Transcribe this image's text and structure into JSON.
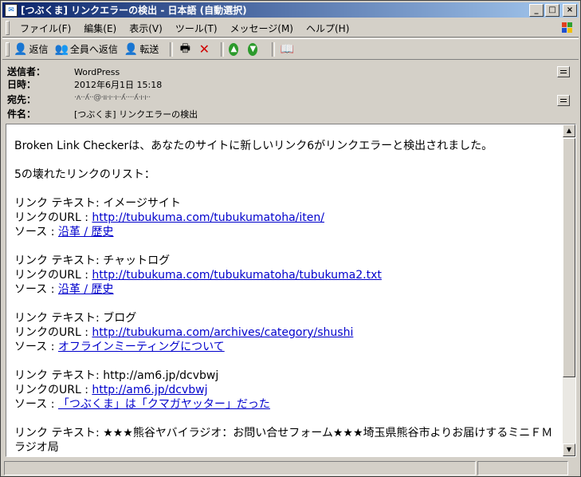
{
  "window": {
    "title": "[つぶくま] リンクエラーの検出 - 日本語 (自動選択)",
    "controls": [
      "_",
      "□",
      "×"
    ]
  },
  "menu": [
    "ファイル(F)",
    "編集(E)",
    "表示(V)",
    "ツール(T)",
    "メッセージ(M)",
    "ヘルプ(H)"
  ],
  "toolbar": {
    "reply": "返信",
    "reply_all": "全員へ返信",
    "forward": "転送"
  },
  "header": {
    "from_label": "送信者：",
    "from": "WordPress",
    "date_label": "日時：",
    "date": "2012年6月1日 15:18",
    "to_label": "宛先：",
    "to": "·ʌ··ʎ··@·ıı·ı··ı··ʎ····ʎ·ı·ı··",
    "subject_label": "件名：",
    "subject": "[つぶくま] リンクエラーの検出"
  },
  "body": {
    "intro": "Broken Link Checkerは、あなたのサイトに新しいリンク6がリンクエラーと検出されました。",
    "list_title": "5の壊れたリンクのリスト：",
    "text_label": "リンク テキスト: ",
    "url_label": "リンクのURL : ",
    "source_label": "ソース : ",
    "links": [
      {
        "text": "イメージサイト",
        "url": "http://tubukuma.com/tubukumatoha/iten/",
        "source": "沿革 / 歴史"
      },
      {
        "text": "チャットログ",
        "url": "http://tubukuma.com/tubukumatoha/tubukuma2.txt",
        "source": "沿革 / 歴史"
      },
      {
        "text": "ブログ",
        "url": "http://tubukuma.com/archives/category/shushi",
        "source": "オフラインミーティングについて"
      },
      {
        "text": "http://am6.jp/dcvbwj",
        "url": "http://am6.jp/dcvbwj",
        "source": "「つぶくま」は「クマガヤッター」だった"
      }
    ],
    "last_text": "★★★熊谷ヤバイラジオ：お問い合せフォーム★★★埼玉県熊谷市よりお届けするミニＦＭラジオ局"
  },
  "scrollbar": {
    "up": "▲",
    "down": "▼"
  }
}
